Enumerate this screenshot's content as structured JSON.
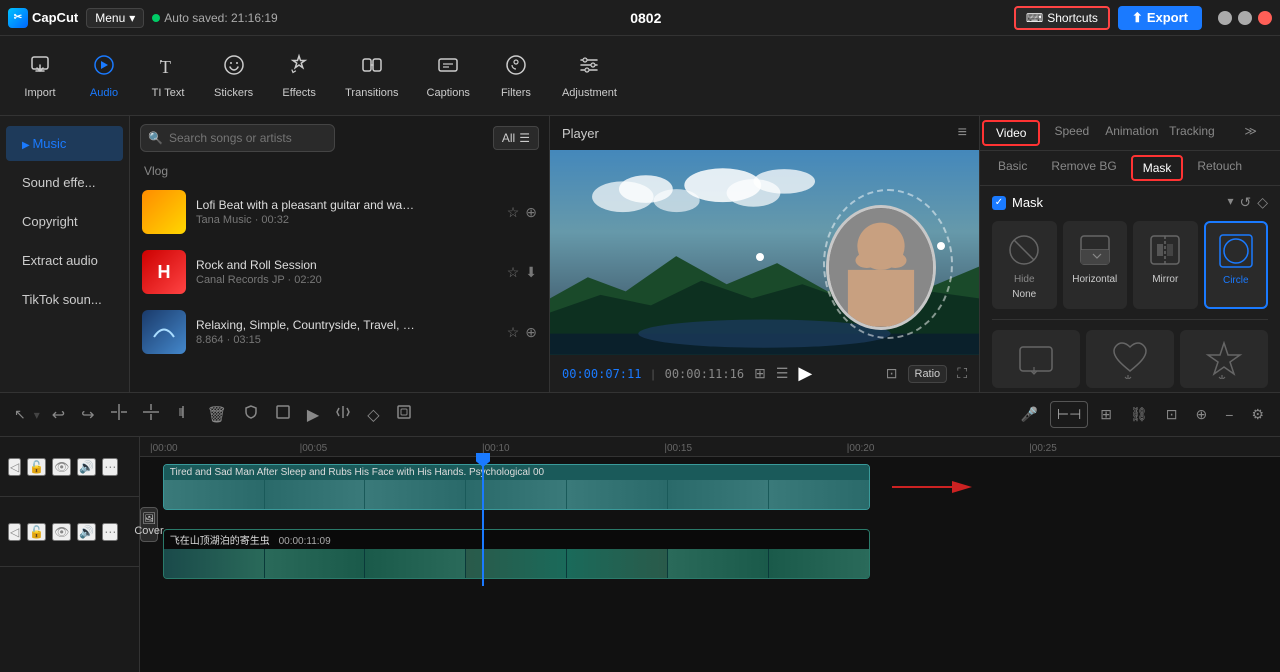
{
  "app": {
    "name": "CapCut",
    "menu_label": "Menu",
    "autosave_text": "Auto saved: 21:16:19",
    "project_id": "0802",
    "window_controls": [
      "minimize",
      "maximize",
      "close"
    ]
  },
  "shortcuts": {
    "label": "Shortcuts"
  },
  "export": {
    "label": "Export"
  },
  "toolbar": {
    "items": [
      {
        "id": "import",
        "label": "Import",
        "icon": "⬆"
      },
      {
        "id": "audio",
        "label": "Audio",
        "icon": "♪"
      },
      {
        "id": "text",
        "label": "TI Text",
        "icon": "T"
      },
      {
        "id": "stickers",
        "label": "Stickers",
        "icon": "😊"
      },
      {
        "id": "effects",
        "label": "Effects",
        "icon": "✨"
      },
      {
        "id": "transitions",
        "label": "Transitions",
        "icon": "⬡"
      },
      {
        "id": "captions",
        "label": "Captions",
        "icon": "💬"
      },
      {
        "id": "filters",
        "label": "Filters",
        "icon": "🎨"
      },
      {
        "id": "adjustment",
        "label": "Adjustment",
        "icon": "⚙"
      }
    ],
    "active": "audio"
  },
  "left_panel": {
    "items": [
      {
        "id": "music",
        "label": "Music",
        "active": true
      },
      {
        "id": "sound_effects",
        "label": "Sound effe..."
      },
      {
        "id": "copyright",
        "label": "Copyright"
      },
      {
        "id": "extract_audio",
        "label": "Extract audio"
      },
      {
        "id": "tiktok",
        "label": "TikTok soun..."
      }
    ]
  },
  "media_panel": {
    "search_placeholder": "Search songs or artists",
    "all_button": "All",
    "section_label": "Vlog",
    "songs": [
      {
        "id": "song1",
        "title": "Lofi Beat with a pleasant guitar and water sou...",
        "artist": "Tana Music",
        "duration": "00:32",
        "thumb_type": "orange"
      },
      {
        "id": "song2",
        "title": "Rock and Roll Session",
        "artist": "Canal Records JP",
        "duration": "02:20",
        "thumb_type": "red",
        "thumb_text": "H"
      },
      {
        "id": "song3",
        "title": "Relaxing, Simple, Countryside, Travel, Nostalgi...",
        "artist": "8.864",
        "duration": "03:15",
        "thumb_type": "blue"
      }
    ]
  },
  "player": {
    "title": "Player",
    "time_current": "00:00:07:11",
    "time_total": "00:00:11:16",
    "ratio_label": "Ratio"
  },
  "right_panel": {
    "tabs": [
      {
        "id": "video",
        "label": "Video",
        "active": true
      },
      {
        "id": "speed",
        "label": "Speed"
      },
      {
        "id": "animation",
        "label": "Animation"
      },
      {
        "id": "tracking",
        "label": "Tracking"
      },
      {
        "id": "more",
        "label": "≫"
      }
    ],
    "sub_tabs": [
      {
        "id": "basic",
        "label": "Basic"
      },
      {
        "id": "remove_bg",
        "label": "Remove BG"
      },
      {
        "id": "mask",
        "label": "Mask",
        "active": true
      },
      {
        "id": "retouch",
        "label": "Retouch"
      }
    ],
    "mask": {
      "label": "Mask",
      "hide_label": "Hide",
      "items_row1": [
        {
          "id": "none",
          "label": "None",
          "icon": "none"
        },
        {
          "id": "horizontal",
          "label": "Horizontal",
          "icon": "horizontal"
        },
        {
          "id": "mirror",
          "label": "Mirror",
          "icon": "mirror"
        },
        {
          "id": "circle",
          "label": "Circle",
          "icon": "circle",
          "active": true
        }
      ],
      "items_row2": [
        {
          "id": "rect",
          "label": "",
          "icon": "rect"
        },
        {
          "id": "heart",
          "label": "",
          "icon": "heart"
        },
        {
          "id": "star",
          "label": "",
          "icon": "star"
        }
      ]
    }
  },
  "timeline": {
    "toolbar_buttons": [
      {
        "id": "pointer",
        "icon": "↖",
        "label": "pointer"
      },
      {
        "id": "undo",
        "icon": "↩",
        "label": "undo"
      },
      {
        "id": "redo",
        "icon": "↪",
        "label": "redo"
      },
      {
        "id": "split",
        "icon": "⚊",
        "label": "split"
      },
      {
        "id": "split2",
        "icon": "⚋",
        "label": "split2"
      },
      {
        "id": "trim",
        "icon": "⚌",
        "label": "trim"
      },
      {
        "id": "delete",
        "icon": "🗑",
        "label": "delete"
      },
      {
        "id": "shield",
        "icon": "⬡",
        "label": "shield"
      },
      {
        "id": "crop",
        "icon": "▬",
        "label": "crop"
      },
      {
        "id": "play",
        "icon": "▶",
        "label": "play"
      },
      {
        "id": "flip",
        "icon": "⬖",
        "label": "flip"
      },
      {
        "id": "diamond",
        "icon": "◇",
        "label": "keyframe"
      },
      {
        "id": "frame",
        "icon": "⬛",
        "label": "frame"
      }
    ],
    "ruler": {
      "marks": [
        "00:00",
        "|00:05",
        "|00:10",
        "|00:15",
        "|00:20",
        "|00:25"
      ]
    },
    "tracks": [
      {
        "id": "track1",
        "clip_title": "Tired and Sad Man After Sleep and Rubs His Face with His Hands. Psychological",
        "clip_code": "00",
        "duration": "00:00:11:16",
        "color": "#2a8a8a"
      },
      {
        "id": "track2",
        "clip_title": "飞在山顶湖泊的寄生虫",
        "duration": "00:00:11:09",
        "color": "#1a6a5a"
      }
    ],
    "cover_label": "Cover",
    "playhead_position": "49%",
    "red_arrow_visible": true
  }
}
